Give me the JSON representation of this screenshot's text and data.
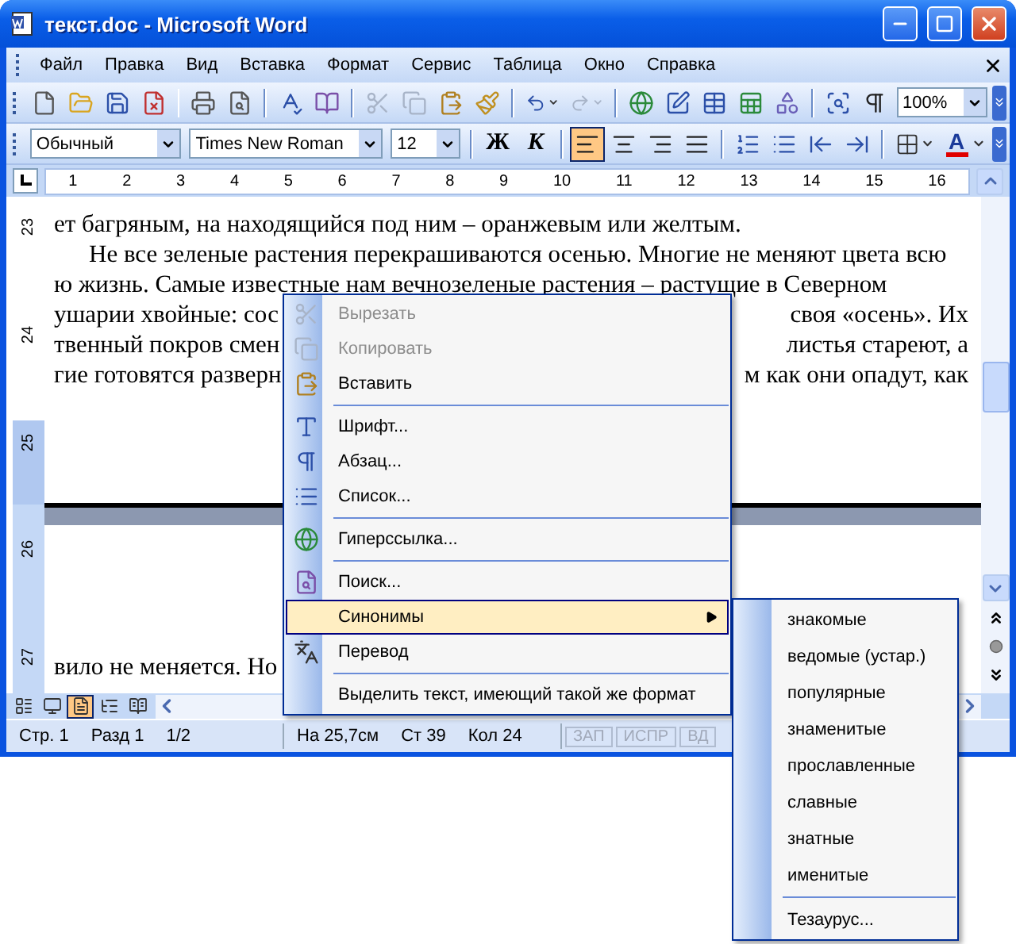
{
  "window": {
    "title": "текст.doc - Microsoft Word"
  },
  "menu_bar": {
    "items": [
      "Файл",
      "Правка",
      "Вид",
      "Вставка",
      "Формат",
      "Сервис",
      "Таблица",
      "Окно",
      "Справка"
    ]
  },
  "standard_toolbar": {
    "groups": [
      [
        {
          "disabled": false
        },
        {
          "disabled": false
        },
        {
          "disabled": false
        },
        {
          "disabled": false
        }
      ],
      [
        {
          "disabled": false
        },
        {
          "disabled": false
        }
      ],
      [
        {
          "disabled": false
        },
        {
          "disabled": false
        }
      ],
      [
        {
          "disabled": true
        },
        {
          "disabled": true
        },
        {
          "disabled": false
        },
        {
          "disabled": false
        }
      ],
      [
        {
          "disabled": false,
          "dropdown": true
        },
        {
          "disabled": true,
          "dropdown": true
        }
      ],
      [
        {
          "disabled": false
        },
        {
          "disabled": false
        },
        {
          "disabled": false
        },
        {
          "disabled": false
        },
        {
          "disabled": false
        }
      ],
      [
        {
          "disabled": false
        },
        {
          "disabled": false
        }
      ]
    ],
    "zoom": "100%"
  },
  "formatting_toolbar": {
    "style": "Обычный",
    "font": "Times New Roman",
    "size": "12",
    "text_buttons": [
      {
        "label": "Ж",
        "kind": "bold"
      },
      {
        "label": "К",
        "kind": "italic"
      }
    ],
    "alignment": [
      {
        "selected": true
      },
      {
        "selected": false
      },
      {
        "selected": false
      },
      {
        "selected": false
      }
    ],
    "font_color": {
      "label": "A",
      "color": "#e00000"
    }
  },
  "ruler": {
    "marks": [
      "1",
      "2",
      "3",
      "4",
      "5",
      "6",
      "7",
      "8",
      "9",
      "10",
      "11",
      "12",
      "13",
      "14",
      "15",
      "16"
    ]
  },
  "vertical_ruler": {
    "marks": [
      "23",
      "24",
      "25",
      "26",
      "27"
    ]
  },
  "page_1": {
    "lines": [
      {
        "left": "ет багряным, на находящийся под ним – оранжевым или желтым.",
        "paragraph_start": false
      },
      {
        "left": "Не все зеленые растения перекрашиваются осенью. Многие не меняют цвета всю",
        "paragraph_start": true
      },
      {
        "left": "ю жизнь. Самые известные нам вечнозеленые растения – растущие в Северном",
        "paragraph_start": false
      },
      {
        "left": "ушарии хвойные: сос",
        "right": "своя «осень». Их",
        "paragraph_start": false
      },
      {
        "left": "твенный покров смен",
        "right": "листья стареют, а",
        "paragraph_start": false
      },
      {
        "left": "гие готовятся разверн",
        "right": "м как они опадут, как",
        "paragraph_start": false
      }
    ]
  },
  "page_2": {
    "lines": [
      {
        "left": "вило не меняется. Но",
        "paragraph_start": false
      }
    ]
  },
  "view_buttons": [
    {
      "selected": false
    },
    {
      "selected": false
    },
    {
      "selected": true
    },
    {
      "selected": false
    },
    {
      "selected": false
    }
  ],
  "status_bar": {
    "page": [
      "Стр. 1",
      "Разд 1",
      "1/2"
    ],
    "position": [
      "На 25,7см",
      "Ст 39",
      "Кол 24"
    ],
    "modes": [
      {
        "label": "ЗАП",
        "active": false
      },
      {
        "label": "ИСПР",
        "active": false
      },
      {
        "label": "ВД",
        "active": false
      }
    ]
  },
  "context_menu": {
    "groups": [
      [
        {
          "label": "Вырезать",
          "disabled": true,
          "selected": false
        },
        {
          "label": "Копировать",
          "disabled": true,
          "selected": false
        },
        {
          "label": "Вставить",
          "disabled": false,
          "selected": false
        }
      ],
      [
        {
          "label": "Шрифт...",
          "disabled": false,
          "selected": false
        },
        {
          "label": "Абзац...",
          "disabled": false,
          "selected": false
        },
        {
          "label": "Список...",
          "disabled": false,
          "selected": false
        }
      ],
      [
        {
          "label": "Гиперссылка...",
          "disabled": false,
          "selected": false
        }
      ],
      [
        {
          "label": "Поиск...",
          "disabled": false,
          "selected": false
        },
        {
          "label": "Синонимы",
          "disabled": false,
          "selected": true,
          "submenu": true
        },
        {
          "label": "Перевод",
          "disabled": false,
          "selected": false
        }
      ],
      [
        {
          "label": "Выделить текст, имеющий такой же формат",
          "disabled": false,
          "selected": false
        }
      ]
    ]
  },
  "synonyms_menu": {
    "groups": [
      [
        "знакомые",
        "ведомые (устар.)",
        "популярные",
        "знаменитые",
        "прославленные",
        "славные",
        "знатные",
        "именитые"
      ],
      [
        "Тезаурус..."
      ]
    ]
  }
}
